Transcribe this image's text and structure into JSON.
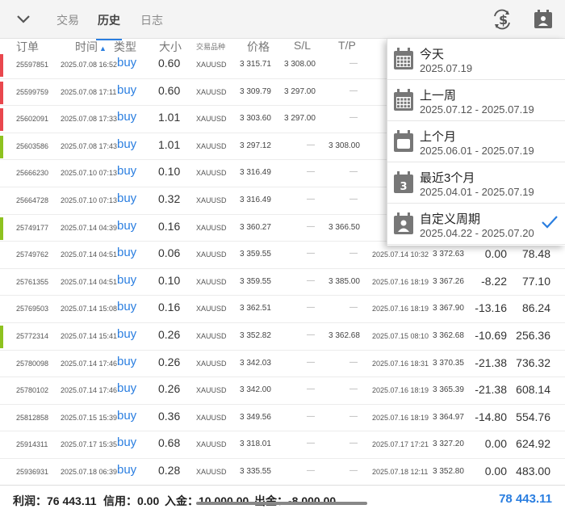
{
  "tabs": [
    {
      "label": "交易"
    },
    {
      "label": "历史"
    },
    {
      "label": "日志"
    }
  ],
  "columns": {
    "order": "订单",
    "time": "时间",
    "type": "类型",
    "volume": "大小",
    "symbol": "交易品种",
    "price": "价格",
    "sl": "S/L",
    "tp": "T/P"
  },
  "colors": {
    "accent": "#2a7ee0",
    "loss": "#e9474d",
    "profit": "#8ec21f"
  },
  "rows": [
    {
      "order": "25597851",
      "time": "2025.07.08 16:52",
      "type": "buy",
      "volume": "0.60",
      "symbol": "XAUUSD",
      "price": "3 315.71",
      "sl": "3 308.00",
      "tp": "—",
      "close_time": "",
      "close_price": "",
      "profit": "",
      "balance": "",
      "mark": "loss"
    },
    {
      "order": "25599759",
      "time": "2025.07.08 17:11",
      "type": "buy",
      "volume": "0.60",
      "symbol": "XAUUSD",
      "price": "3 309.79",
      "sl": "3 297.00",
      "tp": "—",
      "close_time": "",
      "close_price": "",
      "profit": "",
      "balance": "",
      "mark": "loss"
    },
    {
      "order": "25602091",
      "time": "2025.07.08 17:33",
      "type": "buy",
      "volume": "1.01",
      "symbol": "XAUUSD",
      "price": "3 303.60",
      "sl": "3 297.00",
      "tp": "—",
      "close_time": "",
      "close_price": "",
      "profit": "",
      "balance": "",
      "mark": "loss"
    },
    {
      "order": "25603586",
      "time": "2025.07.08 17:43",
      "type": "buy",
      "volume": "1.01",
      "symbol": "XAUUSD",
      "price": "3 297.12",
      "sl": "—",
      "tp": "3 308.00",
      "close_time": "",
      "close_price": "",
      "profit": "",
      "balance": "",
      "mark": "profit"
    },
    {
      "order": "25666230",
      "time": "2025.07.10 07:13",
      "type": "buy",
      "volume": "0.10",
      "symbol": "XAUUSD",
      "price": "3 316.49",
      "sl": "—",
      "tp": "—",
      "close_time": "",
      "close_price": "",
      "profit": "",
      "balance": "",
      "mark": ""
    },
    {
      "order": "25664728",
      "time": "2025.07.10 07:13",
      "type": "buy",
      "volume": "0.32",
      "symbol": "XAUUSD",
      "price": "3 316.49",
      "sl": "—",
      "tp": "—",
      "close_time": "",
      "close_price": "",
      "profit": "",
      "balance": "",
      "mark": ""
    },
    {
      "order": "25749177",
      "time": "2025.07.14 04:39",
      "type": "buy",
      "volume": "0.16",
      "symbol": "XAUUSD",
      "price": "3 360.27",
      "sl": "—",
      "tp": "3 366.50",
      "close_time": "",
      "close_price": "",
      "profit": "",
      "balance": "",
      "mark": "profit"
    },
    {
      "order": "25749762",
      "time": "2025.07.14 04:51",
      "type": "buy",
      "volume": "0.06",
      "symbol": "XAUUSD",
      "price": "3 359.55",
      "sl": "—",
      "tp": "—",
      "close_time": "2025.07.14 10:32",
      "close_price": "3 372.63",
      "profit": "0.00",
      "balance": "78.48",
      "mark": ""
    },
    {
      "order": "25761355",
      "time": "2025.07.14 04:51",
      "type": "buy",
      "volume": "0.10",
      "symbol": "XAUUSD",
      "price": "3 359.55",
      "sl": "—",
      "tp": "3 385.00",
      "close_time": "2025.07.16 18:19",
      "close_price": "3 367.26",
      "profit": "-8.22",
      "balance": "77.10",
      "mark": ""
    },
    {
      "order": "25769503",
      "time": "2025.07.14 15:08",
      "type": "buy",
      "volume": "0.16",
      "symbol": "XAUUSD",
      "price": "3 362.51",
      "sl": "—",
      "tp": "—",
      "close_time": "2025.07.16 18:19",
      "close_price": "3 367.90",
      "profit": "-13.16",
      "balance": "86.24",
      "mark": ""
    },
    {
      "order": "25772314",
      "time": "2025.07.14 15:41",
      "type": "buy",
      "volume": "0.26",
      "symbol": "XAUUSD",
      "price": "3 352.82",
      "sl": "—",
      "tp": "3 362.68",
      "close_time": "2025.07.15 08:10",
      "close_price": "3 362.68",
      "profit": "-10.69",
      "balance": "256.36",
      "mark": "profit"
    },
    {
      "order": "25780098",
      "time": "2025.07.14 17:46",
      "type": "buy",
      "volume": "0.26",
      "symbol": "XAUUSD",
      "price": "3 342.03",
      "sl": "—",
      "tp": "—",
      "close_time": "2025.07.16 18:31",
      "close_price": "3 370.35",
      "profit": "-21.38",
      "balance": "736.32",
      "mark": ""
    },
    {
      "order": "25780102",
      "time": "2025.07.14 17:46",
      "type": "buy",
      "volume": "0.26",
      "symbol": "XAUUSD",
      "price": "3 342.00",
      "sl": "—",
      "tp": "—",
      "close_time": "2025.07.16 18:19",
      "close_price": "3 365.39",
      "profit": "-21.38",
      "balance": "608.14",
      "mark": ""
    },
    {
      "order": "25812858",
      "time": "2025.07.15 15:39",
      "type": "buy",
      "volume": "0.36",
      "symbol": "XAUUSD",
      "price": "3 349.56",
      "sl": "—",
      "tp": "—",
      "close_time": "2025.07.16 18:19",
      "close_price": "3 364.97",
      "profit": "-14.80",
      "balance": "554.76",
      "mark": ""
    },
    {
      "order": "25914311",
      "time": "2025.07.17 15:35",
      "type": "buy",
      "volume": "0.68",
      "symbol": "XAUUSD",
      "price": "3 318.01",
      "sl": "—",
      "tp": "—",
      "close_time": "2025.07.17 17:21",
      "close_price": "3 327.20",
      "profit": "0.00",
      "balance": "624.92",
      "mark": ""
    },
    {
      "order": "25936931",
      "time": "2025.07.18 06:39",
      "type": "buy",
      "volume": "0.28",
      "symbol": "XAUUSD",
      "price": "3 335.55",
      "sl": "—",
      "tp": "—",
      "close_time": "2025.07.18 12:11",
      "close_price": "3 352.80",
      "profit": "0.00",
      "balance": "483.00",
      "mark": ""
    }
  ],
  "periods": [
    {
      "label": "今天",
      "dates": "2025.07.19",
      "icon": "calendar-day-icon",
      "selected": false
    },
    {
      "label": "上一周",
      "dates": "2025.07.12 - 2025.07.19",
      "icon": "calendar-week-icon",
      "selected": false
    },
    {
      "label": "上个月",
      "dates": "2025.06.01 - 2025.07.19",
      "icon": "calendar-month-icon",
      "selected": false
    },
    {
      "label": "最近3个月",
      "dates": "2025.04.01 - 2025.07.19",
      "icon": "calendar-3-icon",
      "selected": false
    },
    {
      "label": "自定义周期",
      "dates": "2025.04.22 - 2025.07.20",
      "icon": "calendar-custom-icon",
      "selected": true
    }
  ],
  "footer": {
    "profit": "利润：76 443.11",
    "credit": "信用：0.00",
    "deposit": "入金：10 000.00",
    "withdrawal": "出金：-8 000.00",
    "total": "78 443.11"
  }
}
